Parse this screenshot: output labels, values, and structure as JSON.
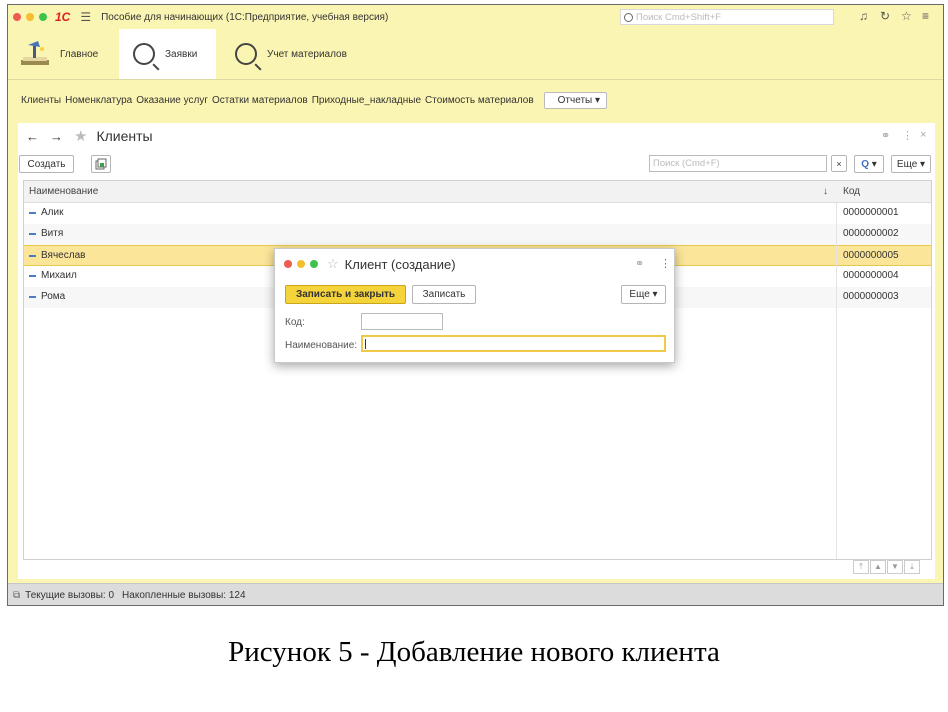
{
  "window": {
    "app_logo": "1С",
    "title": "Пособие для начинающих  (1С:Предприятие, учебная версия)",
    "search_placeholder": "Поиск Cmd+Shift+F",
    "traffic_lights": [
      "#ee5b52",
      "#f6be2f",
      "#3fc24b"
    ]
  },
  "sections": [
    {
      "label": "Главное",
      "icon": "desk-lamp-icon"
    },
    {
      "label": "Заявки",
      "icon": "search-icon",
      "active": true
    },
    {
      "label": "Учет материалов",
      "icon": "search-icon"
    }
  ],
  "commands": {
    "items": [
      "Клиенты",
      "Номенклатура",
      "Оказание услуг",
      "Остатки материалов",
      "Приходные_накладные",
      "Стоимость материалов"
    ],
    "reports_label": "Отчеты"
  },
  "form": {
    "title": "Клиенты",
    "create_label": "Создать",
    "search_placeholder": "Поиск (Cmd+F)",
    "search_button_label": "Q",
    "more_label": "Еще",
    "columns": {
      "name": "Наименование",
      "sort_indicator": "↓",
      "code": "Код"
    },
    "rows": [
      {
        "name": "Алик",
        "code": "0000000001"
      },
      {
        "name": "Витя",
        "code": "0000000002"
      },
      {
        "name": "Вячеслав",
        "code": "0000000005",
        "selected": true
      },
      {
        "name": "Михаил",
        "code": "0000000004"
      },
      {
        "name": "Рома",
        "code": "0000000003"
      }
    ]
  },
  "dialog": {
    "title": "Клиент (создание)",
    "save_close_label": "Записать и закрыть",
    "save_label": "Записать",
    "more_label": "Еще",
    "code_label": "Код:",
    "code_value": "",
    "name_label": "Наименование:",
    "name_value": ""
  },
  "status": {
    "current_calls": "Текущие вызовы: 0",
    "accumulated_calls": "Накопленные вызовы: 124"
  },
  "caption": "Рисунок 5 - Добавление нового клиента"
}
